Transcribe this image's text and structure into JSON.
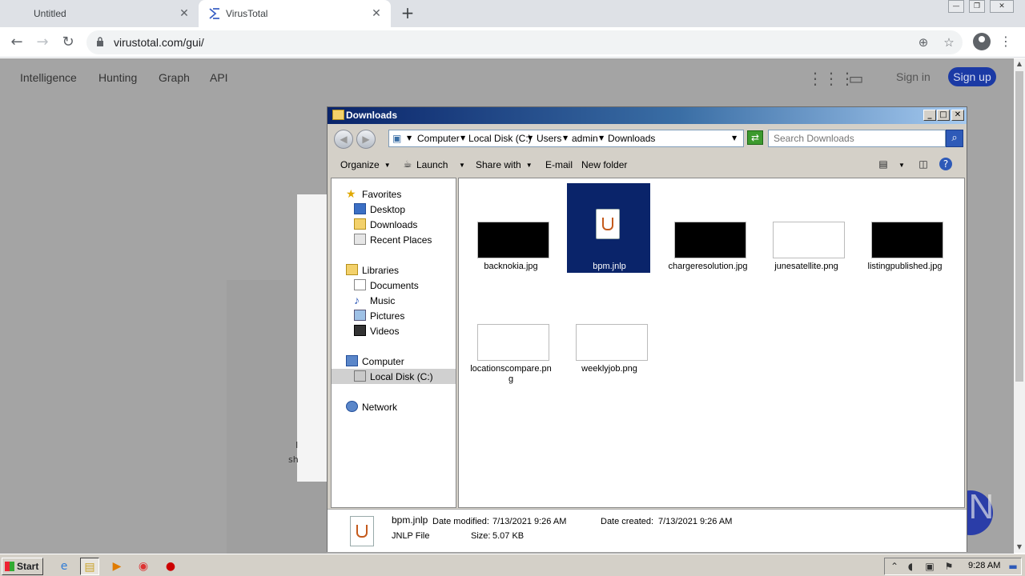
{
  "browser": {
    "tabs": [
      {
        "label": "Untitled",
        "active": false
      },
      {
        "label": "VirusTotal",
        "active": true
      }
    ],
    "url": "virustotal.com/gui/"
  },
  "virustotal": {
    "nav": [
      "Intelligence",
      "Hunting",
      "Graph",
      "API"
    ],
    "sign_in": "Sign in",
    "sign_up": "Sign up",
    "card_fragments": [
      "I",
      "sh"
    ],
    "accent_color": "#1b3aa5"
  },
  "explorer": {
    "title": "Downloads",
    "breadcrumbs": [
      "Computer",
      "Local Disk (C:)",
      "Users",
      "admin",
      "Downloads"
    ],
    "search_placeholder": "Search Downloads",
    "commands": [
      "Organize",
      "Launch",
      "Share with",
      "E-mail",
      "New folder"
    ],
    "nav": {
      "favorites_header": "Favorites",
      "favorites": [
        "Desktop",
        "Downloads",
        "Recent Places"
      ],
      "libraries_header": "Libraries",
      "libraries": [
        "Documents",
        "Music",
        "Pictures",
        "Videos"
      ],
      "computer_header": "Computer",
      "computer_items": [
        "Local Disk (C:)"
      ],
      "network": "Network"
    },
    "files": [
      {
        "name": "backnokia.jpg",
        "thumb": "#000000",
        "selected": false
      },
      {
        "name": "bpm.jnlp",
        "thumb": "jnlp",
        "selected": true
      },
      {
        "name": "chargeresolution.jpg",
        "thumb": "#000000",
        "selected": false
      },
      {
        "name": "junesatellite.png",
        "thumb": "#ffffff",
        "selected": false
      },
      {
        "name": "listingpublished.jpg",
        "thumb": "#000000",
        "selected": false
      },
      {
        "name": "locationscompare.png",
        "thumb": "#ffffff",
        "selected": false
      },
      {
        "name": "weeklyjob.png",
        "thumb": "#ffffff",
        "selected": false
      }
    ],
    "details": {
      "filename": "bpm.jnlp",
      "type": "JNLP File",
      "modified_label": "Date modified:",
      "modified": "7/13/2021 9:26 AM",
      "created_label": "Date created:",
      "created": "7/13/2021 9:26 AM",
      "size_label": "Size:",
      "size": "5.07 KB"
    }
  },
  "taskbar": {
    "start": "Start",
    "clock": "9:28 AM"
  },
  "watermark": "ANY RUN"
}
